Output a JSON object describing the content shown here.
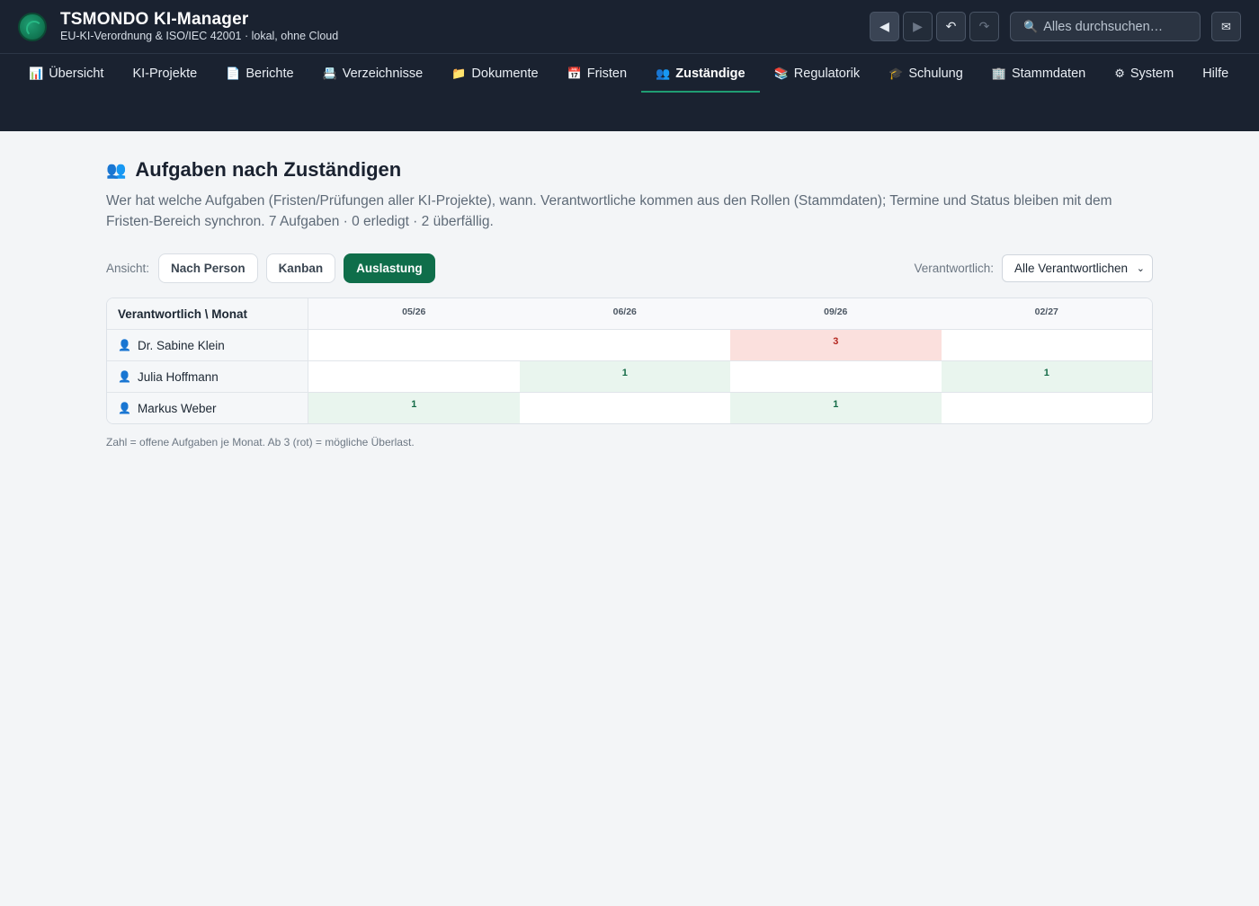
{
  "app": {
    "title": "TSMONDO KI-Manager",
    "subtitle": "EU-KI-Verordnung & ISO/IEC 42001 · lokal, ohne Cloud",
    "search_placeholder": "Alles durchsuchen…",
    "accent_color": "#1f9d72",
    "header_bg": "#1a2230"
  },
  "toolbar": {
    "back_icon": "◀",
    "forward_icon": "▶",
    "undo_icon": "↶",
    "redo_icon": "↷",
    "search_icon": "🔍",
    "mail_icon": "✉"
  },
  "nav": [
    {
      "icon": "📊",
      "label": "Übersicht"
    },
    {
      "icon": "",
      "label": "KI-Projekte"
    },
    {
      "icon": "📄",
      "label": "Berichte"
    },
    {
      "icon": "📇",
      "label": "Verzeichnisse"
    },
    {
      "icon": "📁",
      "label": "Dokumente"
    },
    {
      "icon": "📅",
      "label": "Fristen"
    },
    {
      "icon": "👥",
      "label": "Zuständige"
    },
    {
      "icon": "📚",
      "label": "Regulatorik"
    },
    {
      "icon": "🎓",
      "label": "Schulung"
    },
    {
      "icon": "🏢",
      "label": "Stammdaten"
    },
    {
      "icon": "⚙",
      "label": "System"
    },
    {
      "icon": "",
      "label": "Hilfe"
    }
  ],
  "page": {
    "icon": "👥",
    "title": "Aufgaben nach Zuständigen",
    "description": "Wer hat welche Aufgaben (Fristen/Prüfungen aller KI-Projekte), wann. Verantwortliche kommen aus den Rollen (Stammdaten); Termine und Status bleiben mit dem Fristen-Bereich synchron. 7 Aufgaben · 0 erledigt · 2 überfällig."
  },
  "view": {
    "label": "Ansicht:",
    "options": [
      "Nach Person",
      "Kanban",
      "Auslastung"
    ],
    "active": "Auslastung"
  },
  "filter": {
    "label": "Verantwortlich:",
    "selected": "Alle Verantwortlichen"
  },
  "matrix": {
    "header": "Verantwortlich \\ Monat",
    "months": [
      "05/26",
      "06/26",
      "09/26",
      "02/27"
    ],
    "rows": [
      {
        "name": "Dr. Sabine Klein",
        "counts": [
          null,
          null,
          3,
          null
        ]
      },
      {
        "name": "Julia Hoffmann",
        "counts": [
          null,
          1,
          null,
          1
        ]
      },
      {
        "name": "Markus Weber",
        "counts": [
          1,
          null,
          1,
          null
        ]
      }
    ],
    "note": "Zahl = offene Aufgaben je Monat. Ab 3 (rot) = mögliche Überlast."
  }
}
